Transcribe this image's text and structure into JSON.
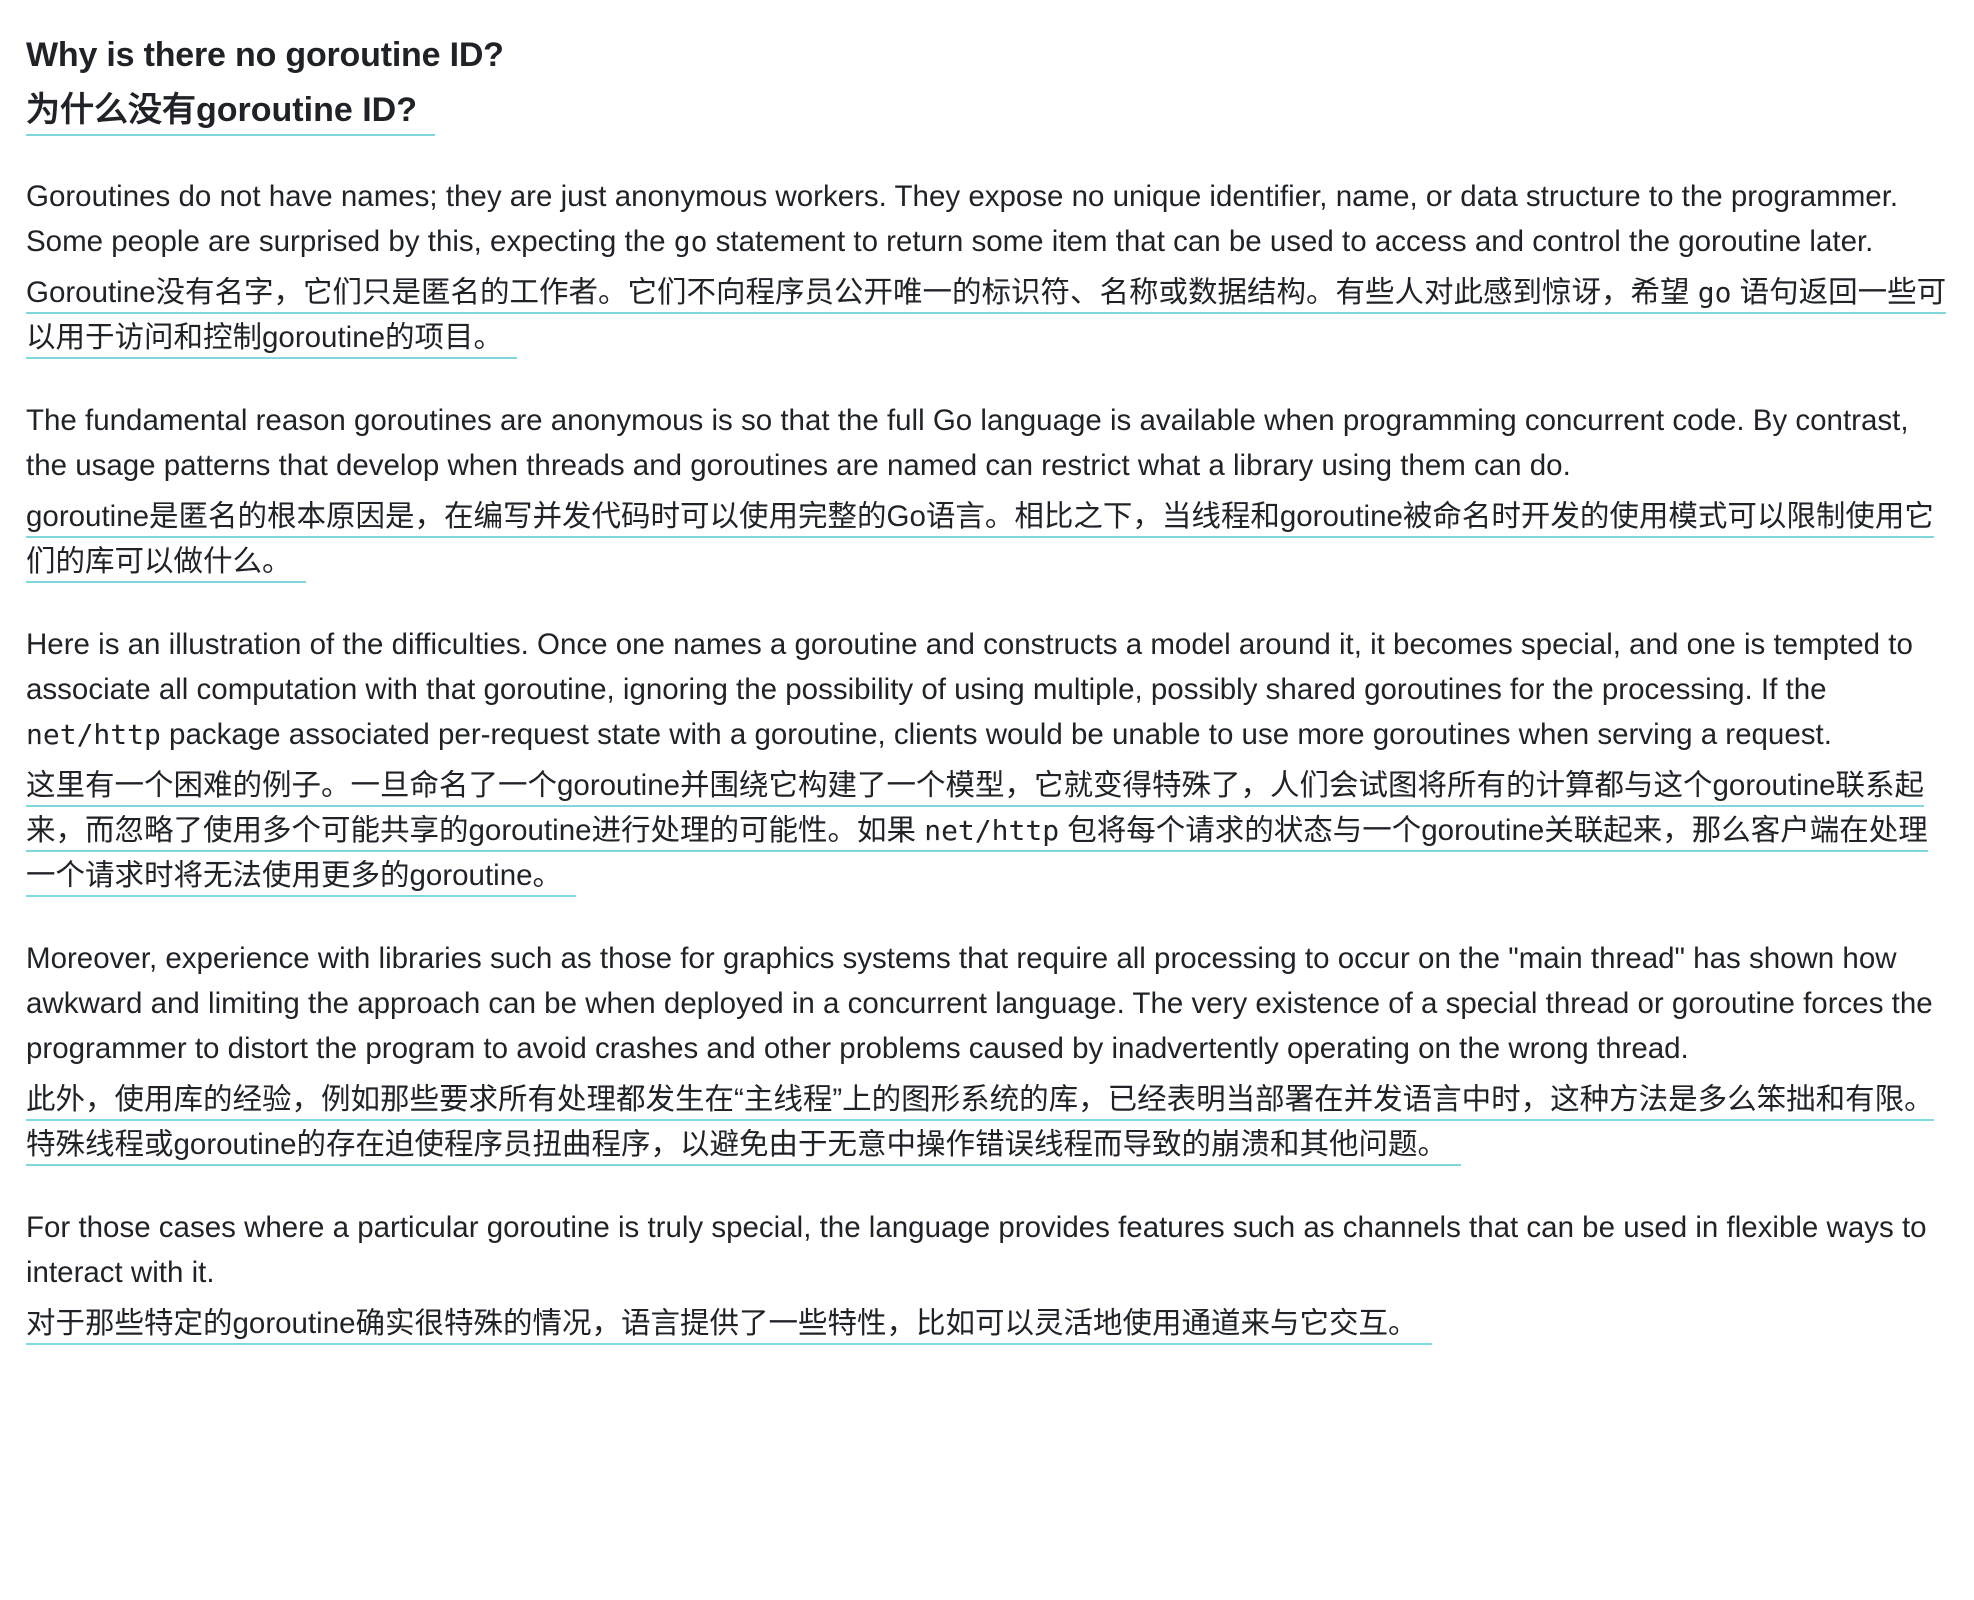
{
  "heading": {
    "en": "Why is there no goroutine ID?",
    "zh": "为什么没有goroutine ID?"
  },
  "sections": [
    {
      "en_parts": [
        "Goroutines do not have names; they are just anonymous workers. They expose no unique identifier, name, or data structure to the programmer. Some people are surprised by this, expecting the ",
        "go",
        " statement to return some item that can be used to access and control the goroutine later."
      ],
      "zh_parts": [
        "Goroutine没有名字，它们只是匿名的工作者。它们不向程序员公开唯一的标识符、名称或数据结构。有些人对此感到惊讶，希望 ",
        "go",
        " 语句返回一些可以用于访问和控制goroutine的项目。"
      ]
    },
    {
      "en": "The fundamental reason goroutines are anonymous is so that the full Go language is available when programming concurrent code. By contrast, the usage patterns that develop when threads and goroutines are named can restrict what a library using them can do.",
      "zh": "goroutine是匿名的根本原因是，在编写并发代码时可以使用完整的Go语言。相比之下，当线程和goroutine被命名时开发的使用模式可以限制使用它们的库可以做什么。"
    },
    {
      "en_parts": [
        "Here is an illustration of the difficulties. Once one names a goroutine and constructs a model around it, it becomes special, and one is tempted to associate all computation with that goroutine, ignoring the possibility of using multiple, possibly shared goroutines for the processing. If the ",
        "net/http",
        " package associated per-request state with a goroutine, clients would be unable to use more goroutines when serving a request."
      ],
      "zh_parts": [
        "这里有一个困难的例子。一旦命名了一个goroutine并围绕它构建了一个模型，它就变得特殊了，人们会试图将所有的计算都与这个goroutine联系起来，而忽略了使用多个可能共享的goroutine进行处理的可能性。如果 ",
        "net/http",
        " 包将每个请求的状态与一个goroutine关联起来，那么客户端在处理一个请求时将无法使用更多的goroutine。"
      ]
    },
    {
      "en": "Moreover, experience with libraries such as those for graphics systems that require all processing to occur on the \"main thread\" has shown how awkward and limiting the approach can be when deployed in a concurrent language. The very existence of a special thread or goroutine forces the programmer to distort the program to avoid crashes and other problems caused by inadvertently operating on the wrong thread.",
      "zh": "此外，使用库的经验，例如那些要求所有处理都发生在“主线程”上的图形系统的库，已经表明当部署在并发语言中时，这种方法是多么笨拙和有限。特殊线程或goroutine的存在迫使程序员扭曲程序，以避免由于无意中操作错误线程而导致的崩溃和其他问题。"
    },
    {
      "en": "For those cases where a particular goroutine is truly special, the language provides features such as channels that can be used in flexible ways to interact with it.",
      "zh": "对于那些特定的goroutine确实很特殊的情况，语言提供了一些特性，比如可以灵活地使用通道来与它交互。"
    }
  ]
}
